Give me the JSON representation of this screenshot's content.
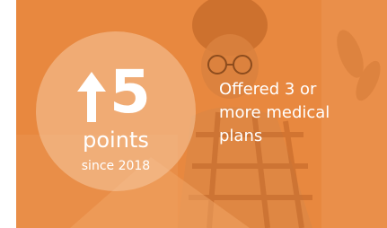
{
  "stat": {
    "value": "5",
    "unit": "points",
    "since": "since 2018",
    "description_lines": [
      "Offered 3 or",
      "more medical",
      "plans"
    ]
  },
  "icons": {
    "direction": "up-arrow-icon"
  },
  "colors": {
    "overlay": "#e8883f",
    "circle": "#f6c8a0",
    "text": "#ffffff"
  }
}
